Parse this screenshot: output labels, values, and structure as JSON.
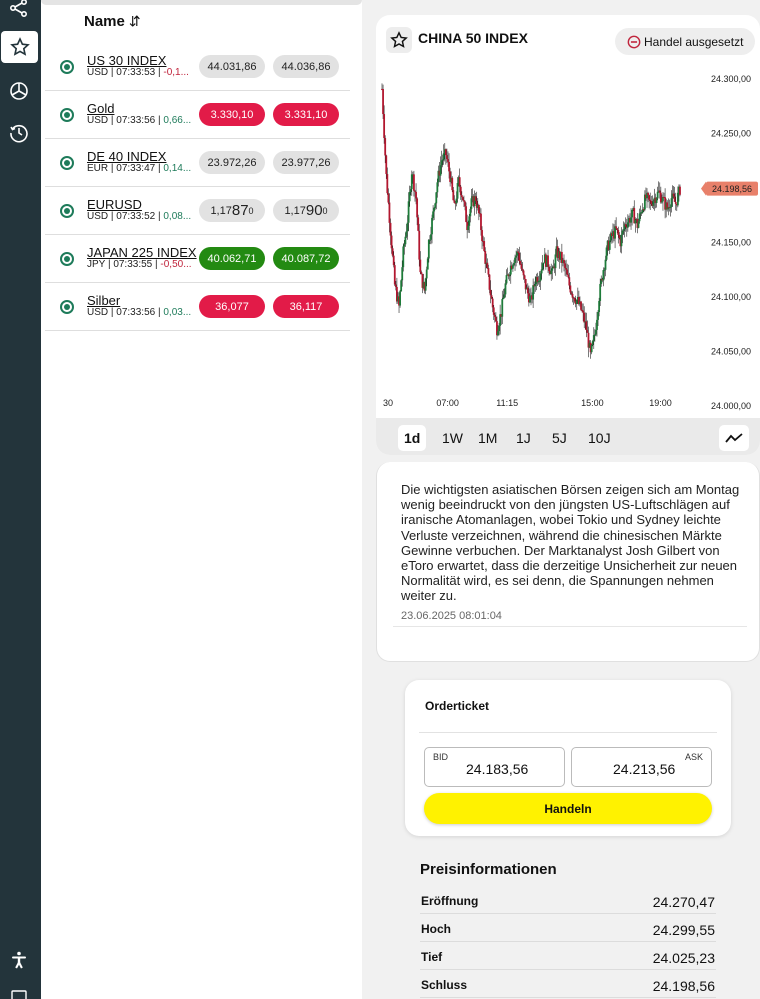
{
  "colors": {
    "sidebar": "#23343b",
    "accent_green": "#1e7b5a",
    "price_red": "#e21b48",
    "price_green": "#238a12",
    "trade_button": "#fff200",
    "current_price_tag": "#e8806a"
  },
  "sidebar": {
    "icons": [
      "share-icon",
      "star-icon",
      "pie-chart-icon",
      "history-icon",
      "accessibility-icon"
    ]
  },
  "watchlist": {
    "header": "Name",
    "sort_icon": "⇵",
    "rows": [
      {
        "name": "US 30 INDEX",
        "meta": "USD | 07:33:53 | ",
        "change": "-0,1...",
        "change_dir": "neg",
        "bid": "44.031,86",
        "ask": "44.036,86",
        "color": "gray"
      },
      {
        "name": "Gold",
        "meta": "USD | 07:33:56 | ",
        "change": "0,66...",
        "change_dir": "pos",
        "bid": "3.330,10",
        "ask": "3.331,10",
        "color": "red"
      },
      {
        "name": "DE 40 INDEX",
        "meta": "EUR | 07:33:47 | ",
        "change": "0,14...",
        "change_dir": "pos",
        "bid": "23.972,26",
        "ask": "23.977,26",
        "color": "gray"
      },
      {
        "name": "EURUSD",
        "meta": "USD | 07:33:52 | ",
        "change": "0,08...",
        "change_dir": "pos",
        "bid": "1,1787",
        "ask": "1,1790",
        "color": "gray",
        "fx": true,
        "bid_parts": [
          "1,17",
          "87",
          "0"
        ],
        "ask_parts": [
          "1,17",
          "90",
          "0"
        ]
      },
      {
        "name": "JAPAN 225 INDEX",
        "meta": "JPY | 07:33:55 | ",
        "change": "-0,50...",
        "change_dir": "neg",
        "bid": "40.062,71",
        "ask": "40.087,72",
        "color": "green"
      },
      {
        "name": "Silber",
        "meta": "USD | 07:33:56 | ",
        "change": "0,03...",
        "change_dir": "pos",
        "bid": "36,077",
        "ask": "36,117",
        "color": "red"
      }
    ]
  },
  "instrument": {
    "title": "CHINA 50 INDEX",
    "status": "Handel ausgesetzt"
  },
  "chart_data": {
    "type": "candlestick",
    "title": "CHINA 50 INDEX",
    "x_ticks": [
      "30",
      "07:00",
      "11:15",
      "15:00",
      "19:00"
    ],
    "y_ticks": [
      "24.300,00",
      "24.250,00",
      "24.200,00",
      "24.150,00",
      "24.100,00",
      "24.050,00",
      "24.000,00"
    ],
    "ylim": [
      24000,
      24300
    ],
    "current_price": "24.198,56",
    "current_value": 24198.56,
    "close_path": [
      [
        0,
        24290
      ],
      [
        2,
        24210
      ],
      [
        4,
        24160
      ],
      [
        6,
        24110
      ],
      [
        8,
        24090
      ],
      [
        10,
        24140
      ],
      [
        12,
        24170
      ],
      [
        14,
        24215
      ],
      [
        16,
        24190
      ],
      [
        18,
        24120
      ],
      [
        20,
        24105
      ],
      [
        22,
        24150
      ],
      [
        24,
        24175
      ],
      [
        26,
        24205
      ],
      [
        28,
        24225
      ],
      [
        30,
        24230
      ],
      [
        32,
        24210
      ],
      [
        34,
        24180
      ],
      [
        36,
        24205
      ],
      [
        38,
        24190
      ],
      [
        40,
        24165
      ],
      [
        42,
        24185
      ],
      [
        44,
        24190
      ],
      [
        46,
        24170
      ],
      [
        48,
        24140
      ],
      [
        50,
        24115
      ],
      [
        52,
        24090
      ],
      [
        54,
        24070
      ],
      [
        56,
        24085
      ],
      [
        58,
        24110
      ],
      [
        60,
        24125
      ],
      [
        62,
        24135
      ],
      [
        64,
        24140
      ],
      [
        66,
        24120
      ],
      [
        68,
        24105
      ],
      [
        70,
        24095
      ],
      [
        72,
        24115
      ],
      [
        74,
        24120
      ],
      [
        76,
        24135
      ],
      [
        78,
        24130
      ],
      [
        80,
        24120
      ],
      [
        82,
        24140
      ],
      [
        84,
        24135
      ],
      [
        86,
        24125
      ],
      [
        88,
        24110
      ],
      [
        90,
        24100
      ],
      [
        92,
        24095
      ],
      [
        94,
        24085
      ],
      [
        96,
        24070
      ],
      [
        98,
        24045
      ],
      [
        100,
        24065
      ],
      [
        102,
        24100
      ],
      [
        104,
        24125
      ],
      [
        106,
        24145
      ],
      [
        108,
        24155
      ],
      [
        110,
        24160
      ],
      [
        112,
        24150
      ],
      [
        114,
        24165
      ],
      [
        116,
        24170
      ],
      [
        118,
        24175
      ],
      [
        120,
        24165
      ],
      [
        122,
        24180
      ],
      [
        124,
        24190
      ],
      [
        126,
        24185
      ],
      [
        128,
        24190
      ],
      [
        130,
        24195
      ],
      [
        132,
        24188
      ],
      [
        134,
        24180
      ],
      [
        136,
        24190
      ],
      [
        138,
        24185
      ],
      [
        140,
        24198
      ]
    ],
    "x_max": 140,
    "timeframes": [
      "1d",
      "1W",
      "1M",
      "1J",
      "5J",
      "10J"
    ],
    "active_timeframe": "1d",
    "chart_type_icon": "line-chart-icon"
  },
  "news": {
    "text": "Die wichtigsten asiatischen Börsen zeigen sich am Montag wenig beeindruckt von den jüngsten US-Luftschlägen auf iranische Atomanlagen, wobei Tokio und Sydney leichte Verluste verzeichnen, während die chinesischen Märkte Gewinne verbuchen. Der Marktanalyst Josh Gilbert von eToro erwartet, dass die derzeitige Unsicherheit zur neuen Normalität wird, es sei denn, die Spannungen nehmen weiter zu.",
    "date": "23.06.2025 08:01:04"
  },
  "order": {
    "title": "Orderticket",
    "bid_label": "BID",
    "bid_value": "24.183,56",
    "ask_label": "ASK",
    "ask_value": "24.213,56",
    "trade_label": "Handeln"
  },
  "priceinfo": {
    "title": "Preisinformationen",
    "rows": [
      {
        "label": "Eröffnung",
        "value": "24.270,47"
      },
      {
        "label": "Hoch",
        "value": "24.299,55"
      },
      {
        "label": "Tief",
        "value": "24.025,23"
      },
      {
        "label": "Schluss",
        "value": "24.198,56"
      }
    ]
  }
}
